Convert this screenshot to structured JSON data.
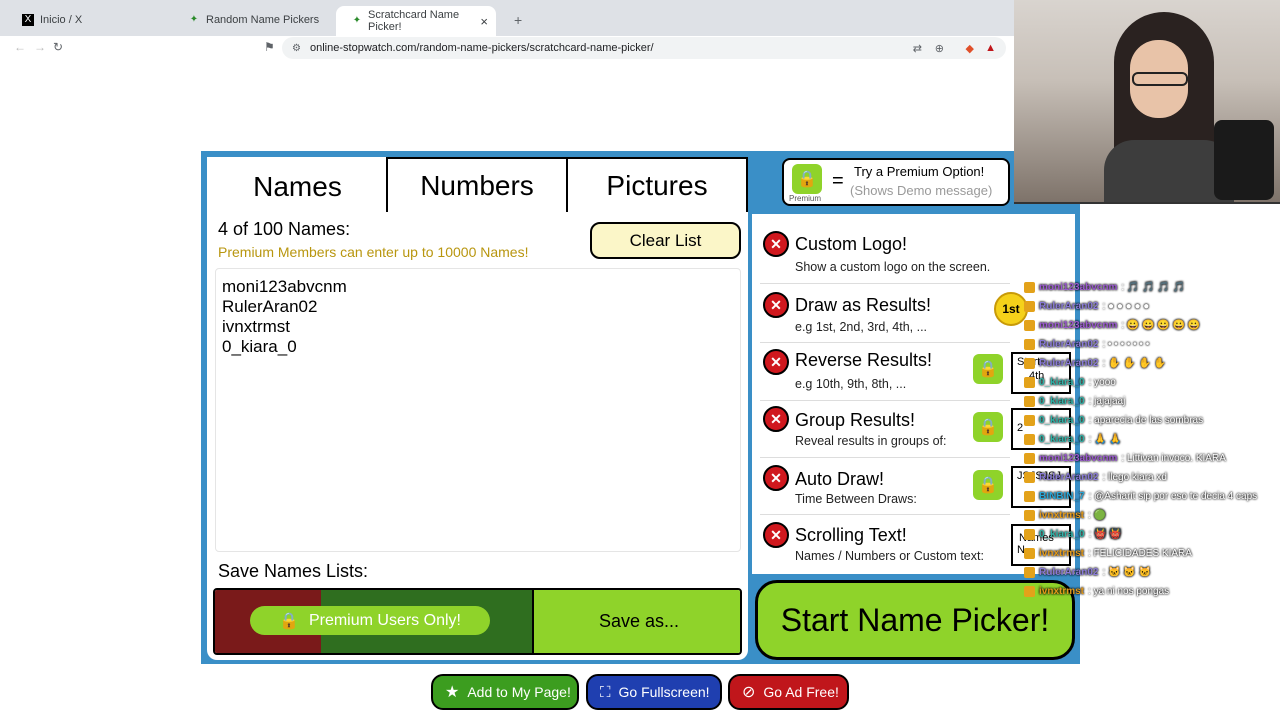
{
  "browser": {
    "tabs": [
      {
        "label": "Inicio / X",
        "icon": "x-logo-icon"
      },
      {
        "label": "Random Name Pickers",
        "icon": "picker-favicon"
      },
      {
        "label": "Scratchcard Name Picker!",
        "icon": "picker-favicon",
        "active": true
      }
    ],
    "new_tab": "+",
    "close_tab": "×",
    "url": "online-stopwatch.com/random-name-pickers/scratchcard-name-picker/"
  },
  "app": {
    "tabs": [
      "Names",
      "Numbers",
      "Pictures"
    ],
    "premium_hint": {
      "title": "Try a Premium Option!",
      "subtitle": "(Shows Demo message)",
      "equals": "=",
      "lock_label": "Premium"
    },
    "count_label": "4 of 100 Names:",
    "premium_note": "Premium Members can enter  up to 10000 Names!",
    "clear_label": "Clear List",
    "names": [
      "moni123abvcnm",
      "RulerAran02",
      "ivnxtrmst",
      "0_kiara_0"
    ],
    "save_lists_label": "Save Names Lists:",
    "premium_only_label": "Premium Users Only!",
    "save_as_label": "Save as...",
    "start_label": "Start Name Picker!",
    "options": [
      {
        "title": "Custom Logo!",
        "desc": "Show a custom logo on the screen."
      },
      {
        "title": "Draw as Results!",
        "desc": "e.g 1st, 2nd, 3rd, 4th, ..."
      },
      {
        "title": "Reverse Results!",
        "desc": "e.g 10th, 9th, 8th, ..."
      },
      {
        "title": "Group Results!",
        "desc": "Reveal results in groups of:"
      },
      {
        "title": "Auto Draw!",
        "desc": "Time Between Draws:"
      },
      {
        "title": "Scrolling Text!",
        "desc": "Names / Numbers or Custom text:"
      }
    ],
    "first_badge": "1st",
    "box_texts": [
      "Start",
      "4th",
      "2",
      "JSJSJSJ",
      "Names",
      "N"
    ]
  },
  "bottom_buttons": [
    {
      "label": "Add to My Page!",
      "color": "#3c9d1f",
      "icon": "star-icon"
    },
    {
      "label": "Go Fullscreen!",
      "color": "#1f3fb0",
      "icon": "fullscreen-icon"
    },
    {
      "label": "Go Ad Free!",
      "color": "#c0161b",
      "icon": "no-ads-icon"
    }
  ],
  "chat": [
    {
      "user": "moni123abvcnm",
      "msg": ": 🎵 🎵 🎵 🎵",
      "color": "#9b59d0"
    },
    {
      "user": "RulerAran02",
      "msg": ": ● ● ● ● ●",
      "color": "#8a7bd8"
    },
    {
      "user": "moni123abvcnm",
      "msg": ": 😀 😀 😀 😀 😀",
      "color": "#9b59d0"
    },
    {
      "user": "RulerAran02",
      "msg": ": • • • • • • •",
      "color": "#8a7bd8"
    },
    {
      "user": "RulerAran02",
      "msg": ": ✋ ✋ ✋ ✋",
      "color": "#8a7bd8"
    },
    {
      "user": "0_kiara_0",
      "msg": ": yooo",
      "color": "#2fb3a8"
    },
    {
      "user": "0_kiara_0",
      "msg": ": jajajaaj",
      "color": "#2fb3a8"
    },
    {
      "user": "0_kiara_0",
      "msg": ": aparecia de las sombras",
      "color": "#2fb3a8"
    },
    {
      "user": "0_kiara_0",
      "msg": ": 🙏 🙏",
      "color": "#2fb3a8"
    },
    {
      "user": "moni123abvcnm",
      "msg": ": Littivan invoco. KIARA",
      "color": "#9b59d0"
    },
    {
      "user": "RulerAran02",
      "msg": ": llego kiara xd",
      "color": "#8a7bd8"
    },
    {
      "user": "BINBIN_7",
      "msg": ": @Asharit sip por eso te decia 4 caps",
      "color": "#2aa6d6"
    },
    {
      "user": "ivnxtrmst",
      "msg": ": 🟢",
      "color": "#e39a1a"
    },
    {
      "user": "0_kiara_0",
      "msg": ": 👹 👹",
      "color": "#2fb3a8"
    },
    {
      "user": "ivnxtrmst",
      "msg": ": FELICIDADES KIARA",
      "color": "#e39a1a"
    },
    {
      "user": "RulerAran02",
      "msg": ": 🐱 🐱 🐱",
      "color": "#8a7bd8"
    },
    {
      "user": "ivnxtrmst",
      "msg": ": ya ni nos pongas",
      "color": "#e39a1a"
    }
  ]
}
